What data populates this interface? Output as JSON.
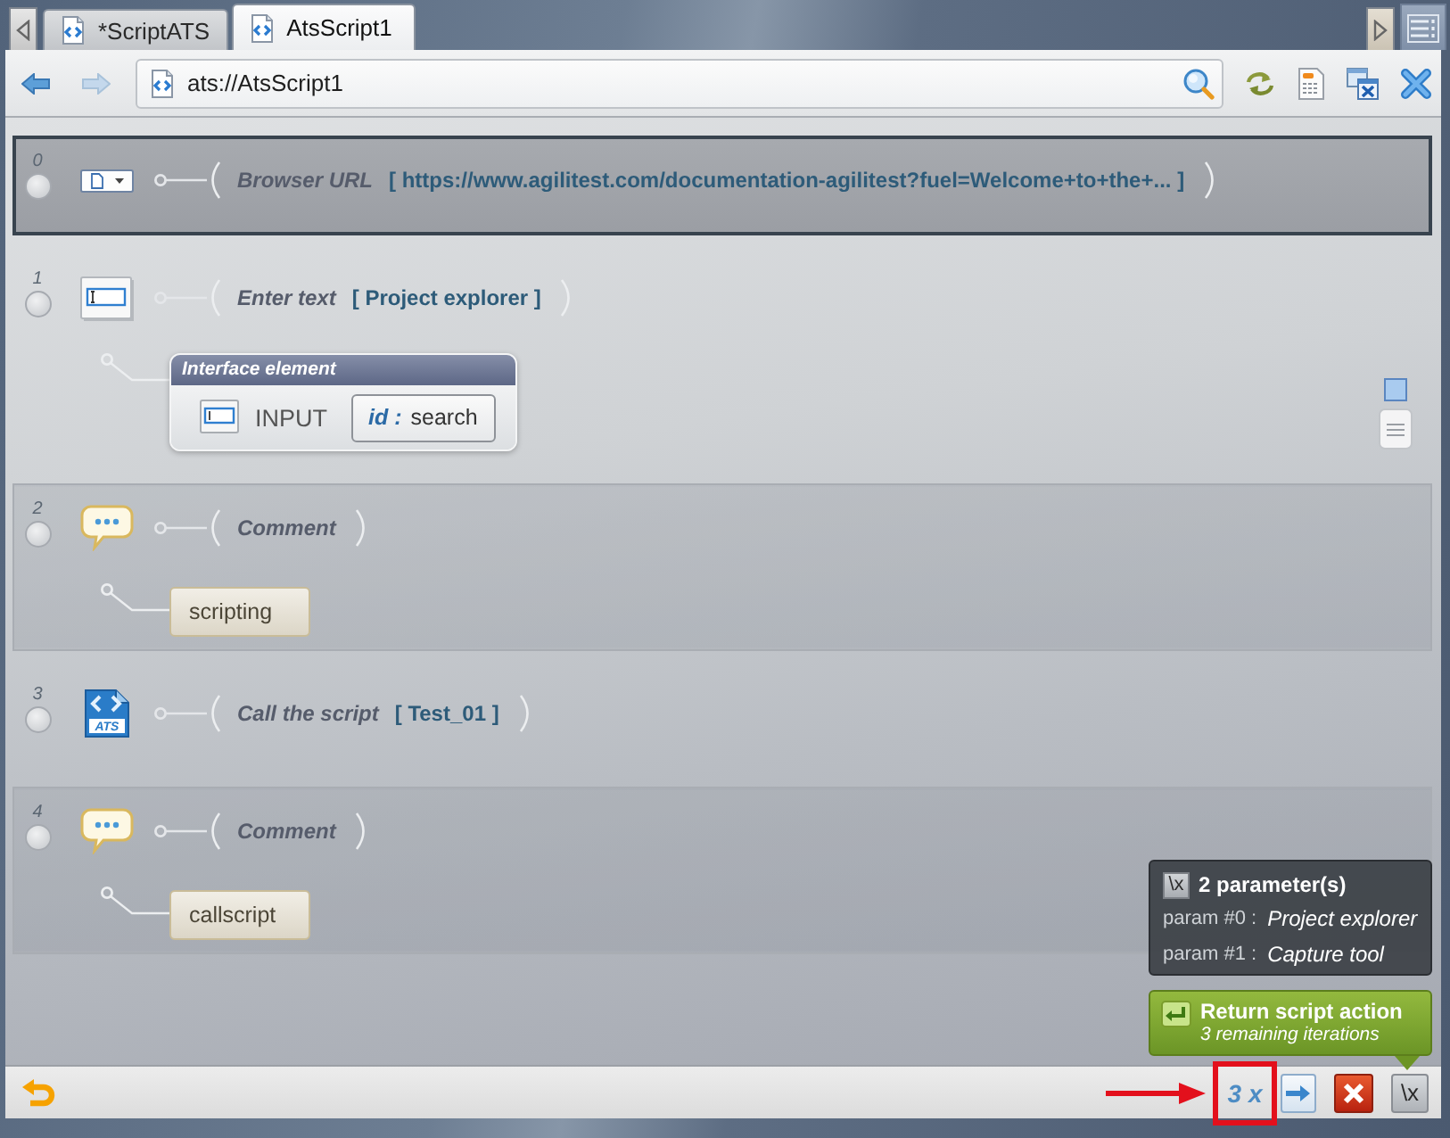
{
  "tabs": [
    {
      "label": "*ScriptATS",
      "selected": false
    },
    {
      "label": "AtsScript1",
      "selected": true
    }
  ],
  "navigation": [
    {
      "kind": "back",
      "disabled": false
    },
    {
      "kind": "forward",
      "disabled": true
    }
  ],
  "address_bar": {
    "value": "ats://AtsScript1"
  },
  "steps": [
    {
      "number": "0",
      "kind": "browser",
      "action": "Browser URL",
      "value": "[ https://www.agilitest.com/documentation-agilitest?fuel=Welcome+to+the+... ]",
      "selected": true
    },
    {
      "number": "1",
      "kind": "input",
      "action": "Enter text",
      "value": "[ Project explorer ]",
      "selected": false,
      "element": {
        "title": "Interface element",
        "tag": "INPUT",
        "locator_key": "id :",
        "locator_value": "search"
      }
    },
    {
      "number": "2",
      "kind": "comment",
      "action": "Comment",
      "selected": false,
      "note": "scripting"
    },
    {
      "number": "3",
      "kind": "script",
      "icon_label": "ATS",
      "action": "Call the script",
      "value": "[ Test_01 ]",
      "selected": false
    },
    {
      "number": "4",
      "kind": "comment",
      "action": "Comment",
      "selected": false,
      "note": "callscript"
    }
  ],
  "parameters_popup": {
    "icon_label": "\\x",
    "title": "2 parameter(s)",
    "params": [
      {
        "label": "param #0 :",
        "value": "Project explorer"
      },
      {
        "label": "param #1 :",
        "value": "Capture tool"
      }
    ]
  },
  "return_callout": {
    "title": "Return script action",
    "subtitle": "3 remaining iterations"
  },
  "bottom_bar": {
    "iterations": "3 x",
    "variables_button": "\\x"
  }
}
